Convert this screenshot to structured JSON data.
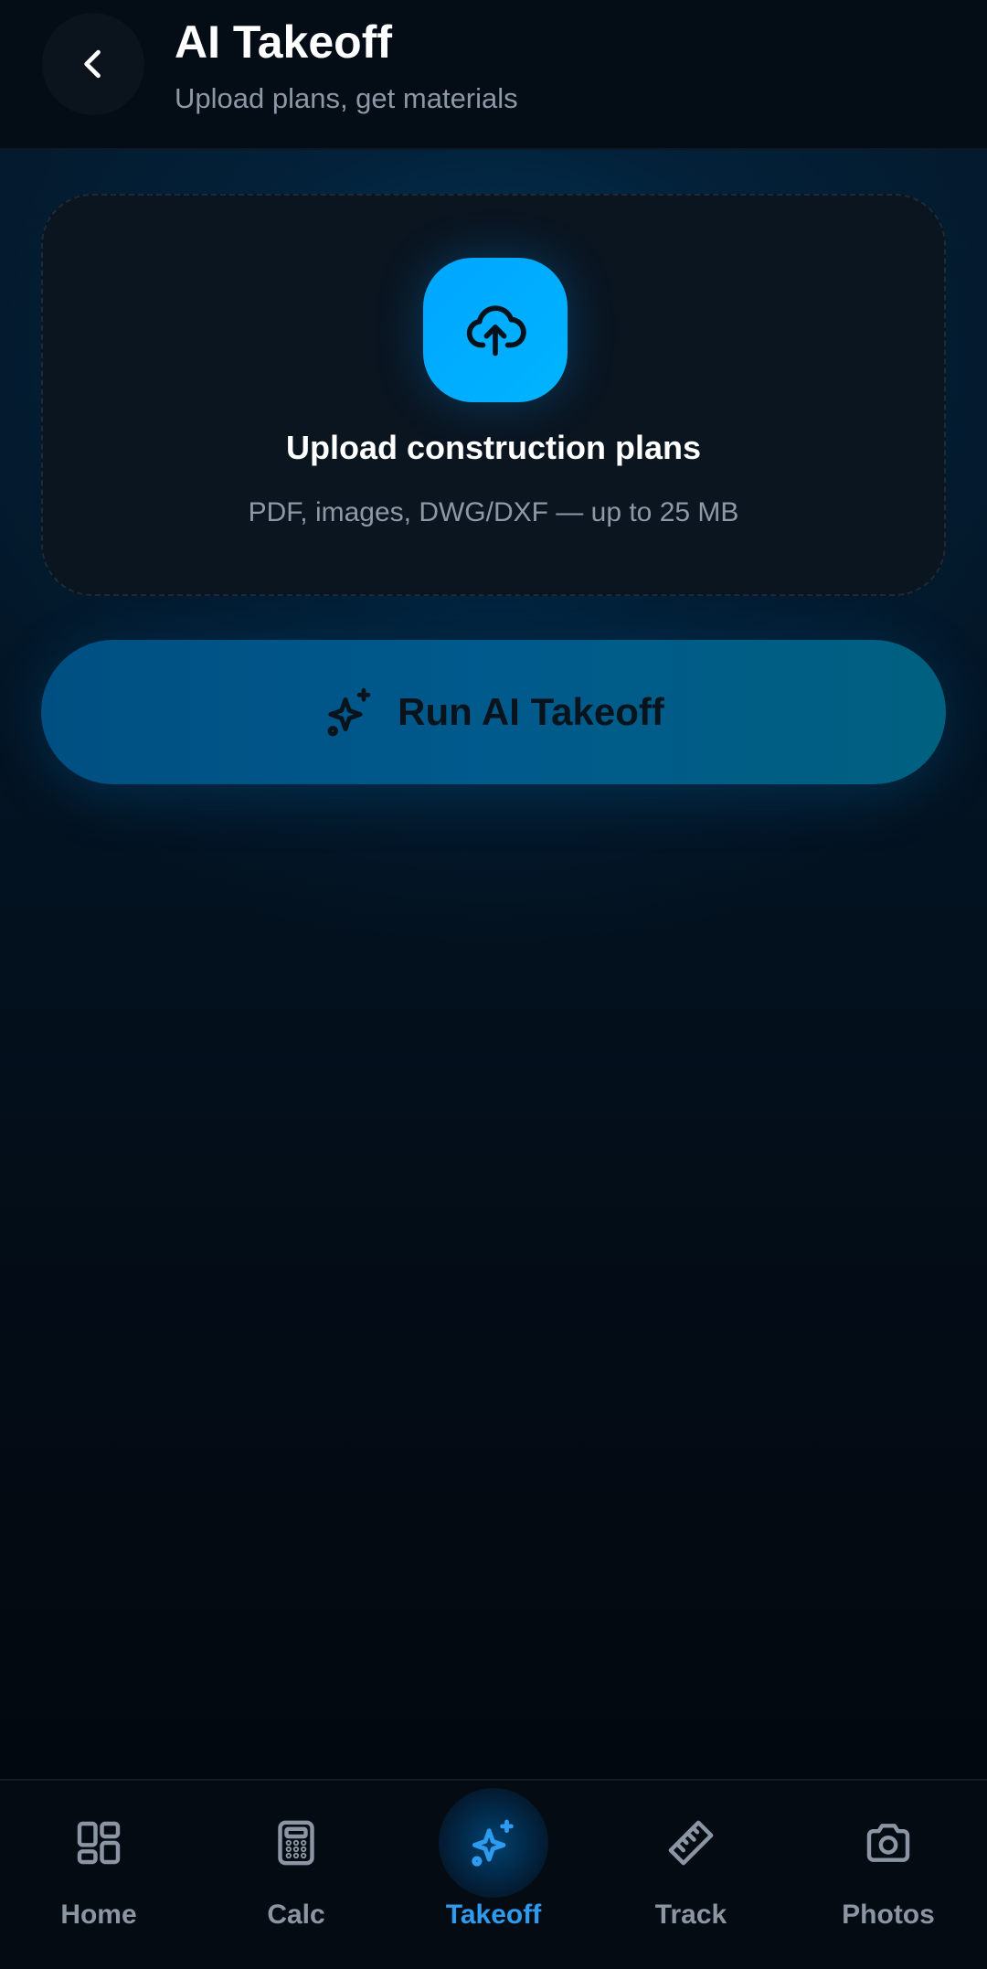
{
  "header": {
    "title": "AI Takeoff",
    "subtitle": "Upload plans, get materials",
    "back_icon": "chevron-left-icon"
  },
  "upload": {
    "icon": "cloud-upload-icon",
    "title": "Upload construction plans",
    "hint": "PDF, images, DWG/DXF — up to 25 MB"
  },
  "run_button": {
    "icon": "sparkles-icon",
    "label": "Run AI Takeoff"
  },
  "nav": {
    "active": "Takeoff",
    "accent_color": "#2d9cf0",
    "items": [
      {
        "label": "Home",
        "icon": "grid-icon"
      },
      {
        "label": "Calc",
        "icon": "calculator-icon"
      },
      {
        "label": "Takeoff",
        "icon": "sparkles-icon"
      },
      {
        "label": "Track",
        "icon": "ruler-icon"
      },
      {
        "label": "Photos",
        "icon": "camera-icon"
      }
    ]
  },
  "colors": {
    "background": "#030a12",
    "upload_tile": "#00aaff",
    "run_button": "#005a8c"
  }
}
